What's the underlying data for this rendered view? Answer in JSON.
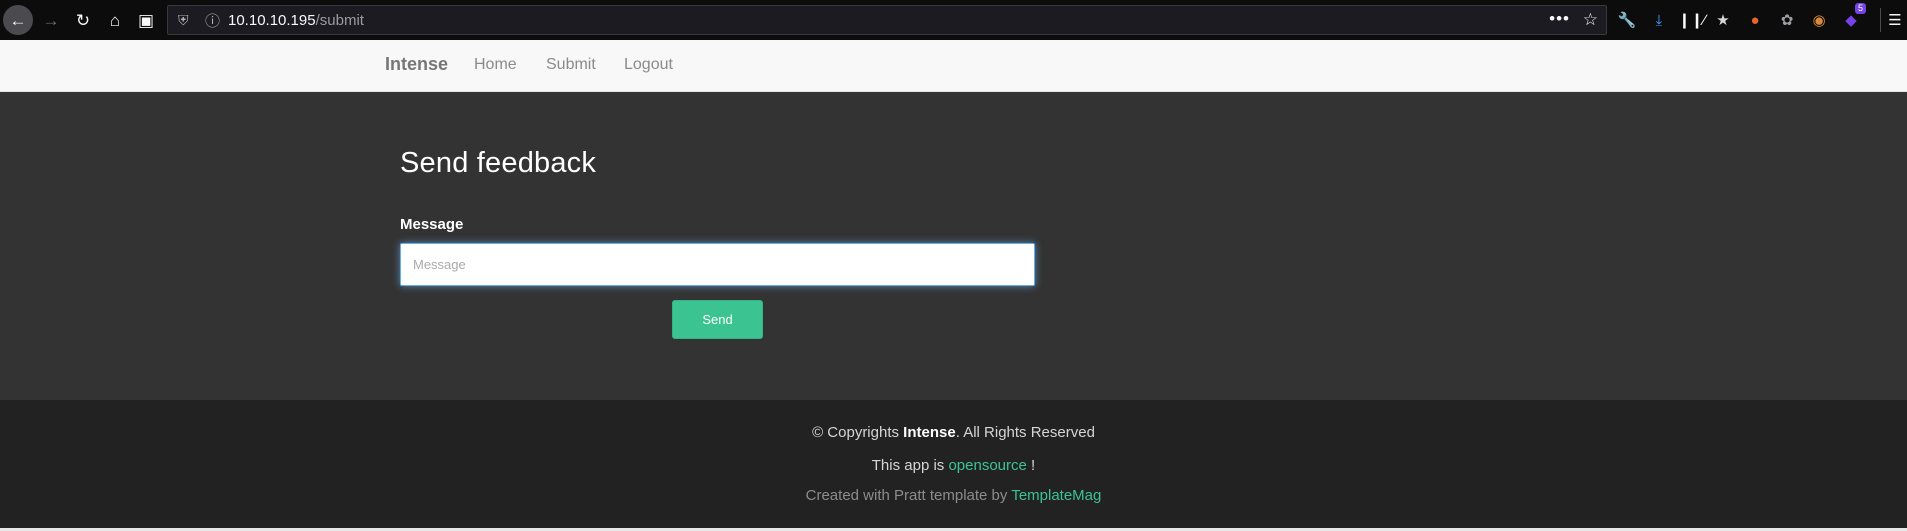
{
  "browser": {
    "url_host": "10.10.10.195",
    "url_path": "/submit",
    "icons": {
      "back": "arrow-left-icon",
      "forward": "arrow-right-icon",
      "reload": "reload-icon",
      "home": "home-icon",
      "reader": "reader-view-icon",
      "shield": "tracking-shield-icon",
      "info": "site-info-icon",
      "page_actions": "more-dots-icon",
      "bookmark": "star-icon",
      "wrench": "wrench-icon",
      "download": "download-icon",
      "library": "library-icon",
      "extension_count_label": "5"
    },
    "colors": {
      "download_accent": "#45a1ff",
      "badge": "#7542e5"
    }
  },
  "navbar": {
    "brand": "Intense",
    "links": [
      "Home",
      "Submit",
      "Logout"
    ]
  },
  "form": {
    "title": "Send feedback",
    "message_label": "Message",
    "message_placeholder": "Message",
    "message_value": "",
    "send_label": "Send"
  },
  "footer": {
    "copyright_prefix": "© Copyrights ",
    "copyright_brand": "Intense",
    "copyright_suffix": ". All Rights Reserved",
    "opensource_prefix": "This app is ",
    "opensource_link": "opensource",
    "opensource_suffix": " !",
    "credit_prefix": "Created with Pratt template by ",
    "credit_link": "TemplateMag"
  },
  "colors": {
    "accent": "#3bc492",
    "main_bg": "#333333",
    "footer_bg": "#222222",
    "navbar_bg": "#f8f8f8"
  }
}
